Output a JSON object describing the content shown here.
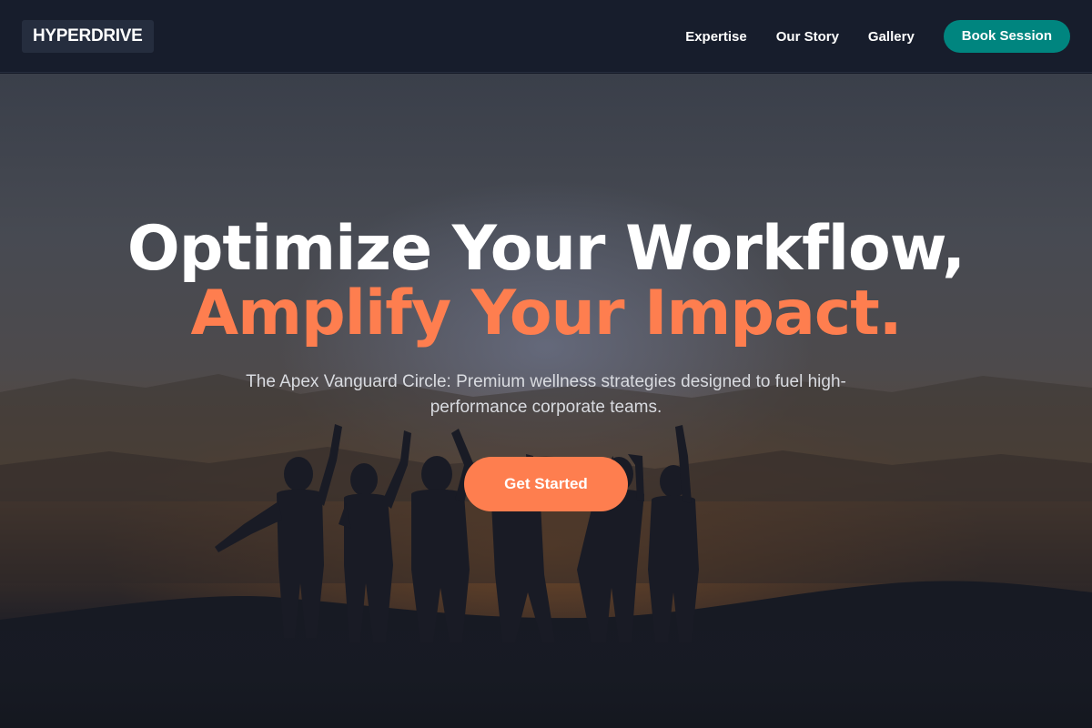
{
  "nav": {
    "logo": "HYPERDRIVE",
    "links": [
      "Expertise",
      "Our Story",
      "Gallery"
    ],
    "cta": "Book Session"
  },
  "hero": {
    "headline": "Optimize Your Workflow,",
    "headline_accent": "Amplify Your Impact.",
    "subtitle": "The Apex Vanguard Circle: Premium wellness strategies designed to fuel high-performance corporate teams.",
    "cta": "Get Started",
    "background_image": "silhouettes-of-people-cheering-at-sunset-icon"
  },
  "colors": {
    "nav_bg": "#171d2c",
    "accent": "#fe7e4f",
    "teal": "#00857f",
    "text": "#ffffff"
  }
}
